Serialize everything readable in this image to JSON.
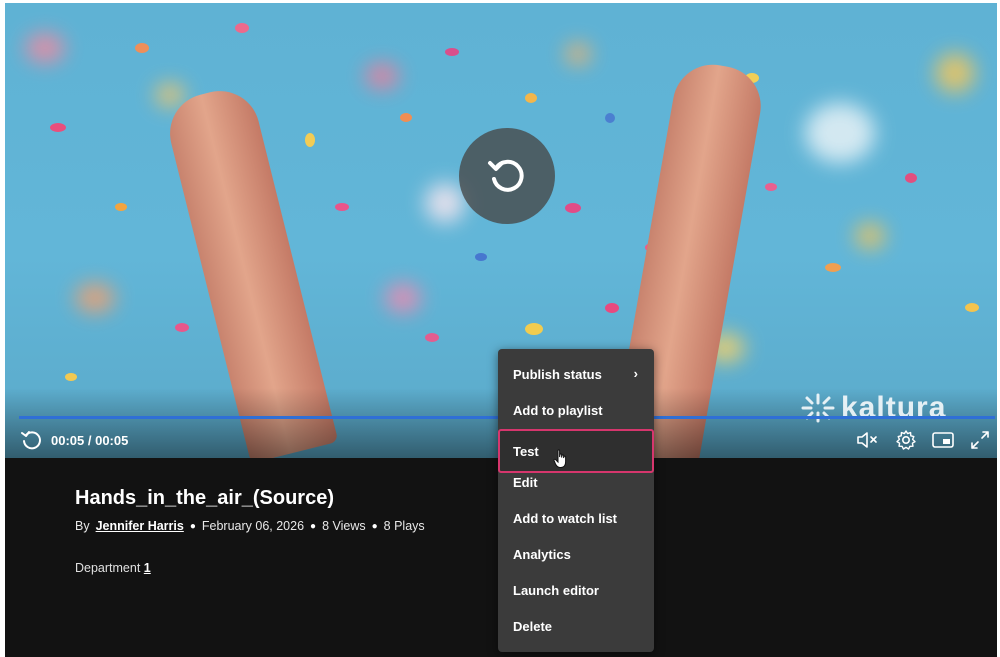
{
  "player": {
    "time_display": "00:05 / 00:05",
    "watermark": "kaltura",
    "progress": 1.0,
    "accent_color": "#2f6fd6"
  },
  "media": {
    "title": "Hands_in_the_air_(Source)",
    "by_label": "By",
    "author": "Jennifer Harris",
    "date": "February 06, 2026",
    "views": "8 Views",
    "plays": "8 Plays",
    "category_label": "Department",
    "category_value": "1"
  },
  "context_menu": {
    "items": [
      {
        "label": "Publish status",
        "has_submenu": true
      },
      {
        "label": "Add to playlist"
      },
      {
        "label": "Test",
        "highlighted": true
      },
      {
        "label": "Edit"
      },
      {
        "label": "Add to watch list"
      },
      {
        "label": "Analytics"
      },
      {
        "label": "Launch editor"
      },
      {
        "label": "Delete"
      }
    ],
    "highlight_color": "#d6366d"
  },
  "icons": {
    "replay": "replay-icon",
    "mute": "volume-muted-icon",
    "settings": "gear-icon",
    "pip": "picture-in-picture-icon",
    "fullscreen": "fullscreen-icon",
    "submenu": "chevron-right-icon"
  }
}
